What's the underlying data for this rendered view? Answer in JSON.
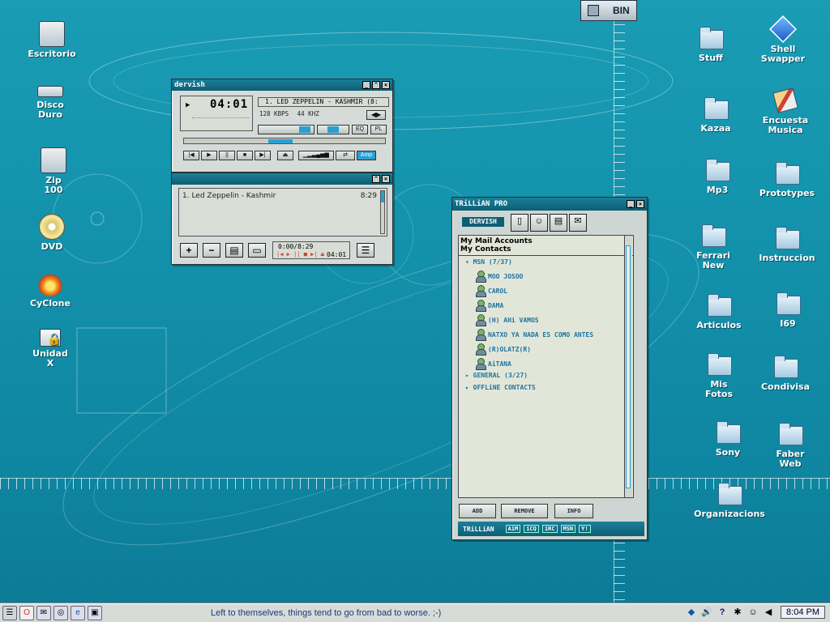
{
  "desktop": {
    "left_icons": [
      {
        "label": "Escritorio",
        "icon": "desktop-icon"
      },
      {
        "label": "Disco Duro",
        "icon": "hard-disk-icon"
      },
      {
        "label": "Zip 100",
        "icon": "zip-drive-icon"
      },
      {
        "label": "DVD",
        "icon": "dvd-icon"
      },
      {
        "label": "CyClone",
        "icon": "cyclone-icon"
      },
      {
        "label": "Unidad X",
        "icon": "unit-lock-icon"
      }
    ],
    "bin_label": "BIN",
    "right_icons": [
      {
        "label": "Stuff",
        "icon": "folder-icon"
      },
      {
        "label": "Shell Swapper",
        "icon": "shell-swapper-icon"
      },
      {
        "label": "Kazaa",
        "icon": "folder-icon"
      },
      {
        "label": "Encuesta Musica",
        "icon": "survey-icon"
      },
      {
        "label": "Mp3",
        "icon": "folder-icon"
      },
      {
        "label": "Prototypes",
        "icon": "folder-icon"
      },
      {
        "label": "Ferrari New",
        "icon": "folder-icon"
      },
      {
        "label": "Instruccion",
        "icon": "folder-icon"
      },
      {
        "label": "Articulos",
        "icon": "folder-icon"
      },
      {
        "label": "I69",
        "icon": "folder-icon"
      },
      {
        "label": "Mis Fotos",
        "icon": "folder-icon"
      },
      {
        "label": "Condivisa",
        "icon": "folder-icon"
      },
      {
        "label": "Sony",
        "icon": "folder-icon"
      },
      {
        "label": "Faber Web",
        "icon": "folder-icon"
      },
      {
        "label": "Organizacions",
        "icon": "folder-icon"
      }
    ]
  },
  "player": {
    "title": "dervish",
    "time": "04:01",
    "track": "1. LED ZEPPELIN - KASHMIR (8:",
    "bitrate": "128 KBPS",
    "khz": "44 KHZ",
    "amp_label": "Amp"
  },
  "playlist": {
    "items": [
      {
        "title": "1. Led Zeppelin - Kashmir",
        "duration": "8:29"
      }
    ],
    "time_display": "0:00/8:29",
    "remaining": "04:01",
    "add_label": "+",
    "remove_label": "−"
  },
  "trillian": {
    "title": "TRiLLiAN PRO",
    "skin_label": "DERVISH",
    "menu": {
      "mail": "My Mail Accounts",
      "contacts": "My Contacts"
    },
    "groups": [
      {
        "name": "MSN (7/37)",
        "expanded": true
      },
      {
        "name": "GENERAL (3/27)",
        "expanded": false
      },
      {
        "name": "OFFLiNE CONTACTS",
        "expanded": false
      }
    ],
    "contacts": [
      "MOO JOSOO",
      "CAROL",
      "DAMA",
      "(H) AHi VAMOS",
      "NATXO YA NADA ES COMO ANTES",
      "(R)OLATZ(R)",
      "AiTANA"
    ],
    "buttons": {
      "add": "ADD",
      "remove": "REMOVE",
      "info": "INFO"
    },
    "footer": {
      "brand": "TRiLLiAN",
      "protocols": [
        "AiM",
        "iCQ",
        "iRC",
        "MSN",
        "Y!"
      ]
    }
  },
  "taskbar": {
    "quote": "Left to themselves, things tend to go from bad to worse. ;-)",
    "clock": "8:04 PM"
  }
}
